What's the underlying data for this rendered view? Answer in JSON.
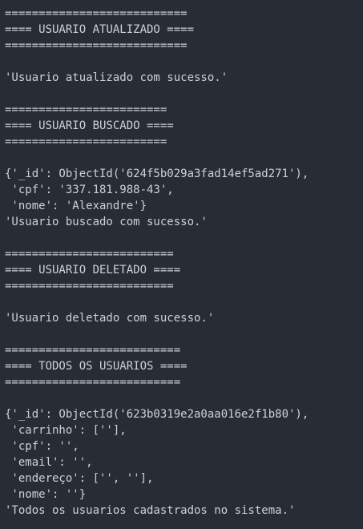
{
  "terminal": {
    "lines": [
      "===========================",
      "==== USUARIO ATUALIZADO ====",
      "===========================",
      "",
      "'Usuario atualizado com sucesso.'",
      "",
      "========================",
      "==== USUARIO BUSCADO ====",
      "========================",
      "",
      "{'_id': ObjectId('624f5b029a3fad14ef5ad271'),",
      " 'cpf': '337.181.988-43',",
      " 'nome': 'Alexandre'}",
      "'Usuario buscado com sucesso.'",
      "",
      "=========================",
      "==== USUARIO DELETADO ====",
      "=========================",
      "",
      "'Usuario deletado com sucesso.'",
      "",
      "==========================",
      "==== TODOS OS USUARIOS ====",
      "==========================",
      "",
      "{'_id': ObjectId('623b0319e2a0aa016e2f1b80'),",
      " 'carrinho': [''],",
      " 'cpf': '',",
      " 'email': '',",
      " 'endereço': ['', ''],",
      " 'nome': ''}",
      "'Todos os usuarios cadastrados no sistema.'"
    ]
  }
}
